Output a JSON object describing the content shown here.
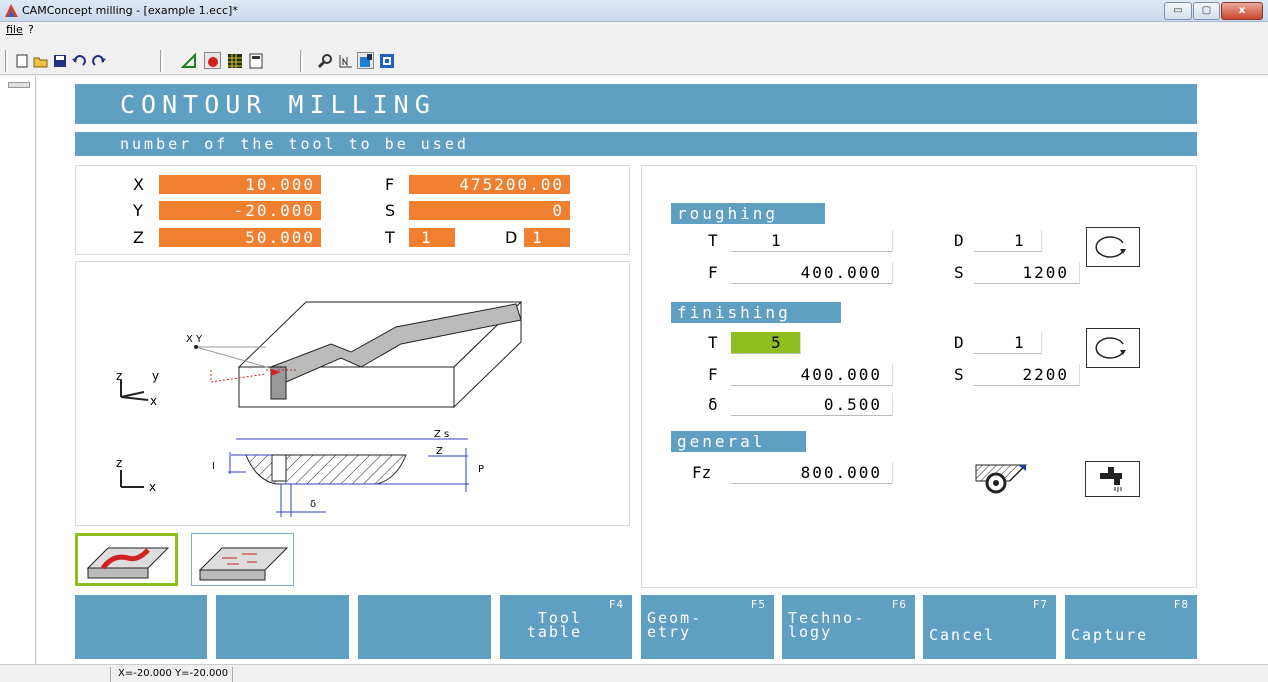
{
  "window": {
    "title": "CAMConcept milling - [example 1.ecc]*",
    "min": "▭",
    "max": "▢",
    "close": "x"
  },
  "menu": {
    "file": "file",
    "help": "?"
  },
  "toolbar": [
    "new-icon",
    "open-icon",
    "save-icon",
    "undo-icon",
    "redo-icon",
    "ruler-icon",
    "cut-icon",
    "grid-icon",
    "calculator-icon",
    "zoom-icon",
    "measure-icon",
    "tool-icon",
    "window-icon"
  ],
  "header": {
    "title": "CONTOUR MILLING",
    "subtitle": "number of the tool to be used"
  },
  "coords": {
    "x_label": "X",
    "x_value": "10.000",
    "y_label": "Y",
    "y_value": "-20.000",
    "z_label": "Z",
    "z_value": "50.000",
    "f_label": "F",
    "f_value": "475200.00",
    "s_label": "S",
    "s_value": "0",
    "t_label": "T",
    "t_value": "1",
    "d_label": "D",
    "d_value": "1"
  },
  "diagram": {
    "xy_label": "X Y",
    "axis_z": "z",
    "axis_y": "y",
    "axis_x": "x",
    "zs": "Z s",
    "z": "Z",
    "i": "I",
    "p": "P",
    "delta": "δ"
  },
  "roughing": {
    "heading": "roughing",
    "t_label": "T",
    "t": "1",
    "d_label": "D",
    "d": "1",
    "f_label": "F",
    "f": "400.000",
    "s_label": "S",
    "s": "1200"
  },
  "finishing": {
    "heading": "finishing",
    "t_label": "T",
    "t": "5",
    "d_label": "D",
    "d": "1",
    "f_label": "F",
    "f": "400.000",
    "s_label": "S",
    "s": "2200",
    "delta_label": "δ",
    "delta": "0.500"
  },
  "general": {
    "heading": "general",
    "fz_label": "Fz",
    "fz": "800.000"
  },
  "fkeys": [
    {
      "num": "",
      "label": ""
    },
    {
      "num": "",
      "label": ""
    },
    {
      "num": "",
      "label": ""
    },
    {
      "num": "F4",
      "label": "Tool\ntable"
    },
    {
      "num": "F5",
      "label": "Geom-\netry"
    },
    {
      "num": "F6",
      "label": "Techno-\nlogy"
    },
    {
      "num": "F7",
      "label": "Cancel"
    },
    {
      "num": "F8",
      "label": "Capture"
    }
  ],
  "status": "X=-20.000 Y=-20.000",
  "colors": {
    "accent": "#5f9fc2",
    "value_bg": "#f08030",
    "active_tool": "#8fbf1f"
  }
}
